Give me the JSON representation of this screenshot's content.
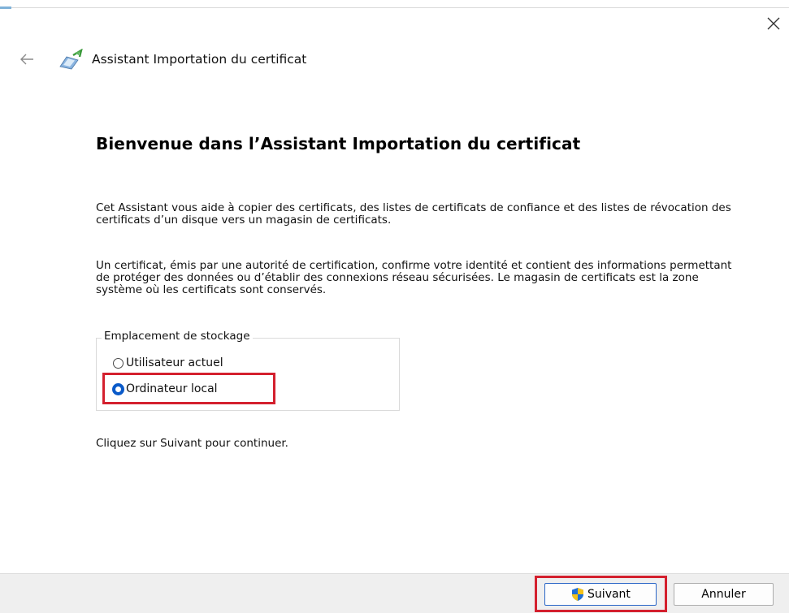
{
  "window": {
    "title": "Assistant Importation du certificat",
    "icons": {
      "back": "back-arrow-icon",
      "close": "close-icon",
      "app": "certificate-icon"
    }
  },
  "main": {
    "heading": "Bienvenue dans l’Assistant Importation du certificat",
    "paragraph1": "Cet Assistant vous aide à copier des certificats, des listes de certificats de confiance et des listes de révocation des certificats d’un disque vers un magasin de certificats.",
    "paragraph2": "Un certificat, émis par une autorité de certification, confirme votre identité et contient des informations permettant de protéger des données ou d’établir des connexions réseau sécurisées. Le magasin de certificats est la zone système où les certificats sont conservés.",
    "storage": {
      "legend": "Emplacement de stockage",
      "options": [
        {
          "label": "Utilisateur actuel",
          "selected": false
        },
        {
          "label": "Ordinateur local",
          "selected": true
        }
      ]
    },
    "continue_text": "Cliquez sur Suivant pour continuer."
  },
  "footer": {
    "next_label": "Suivant",
    "cancel_label": "Annuler",
    "next_icon": "uac-shield-icon"
  },
  "colors": {
    "highlight": "#d4202e",
    "radio_selected": "#0a5ac9",
    "footer_bg": "#efefef"
  }
}
